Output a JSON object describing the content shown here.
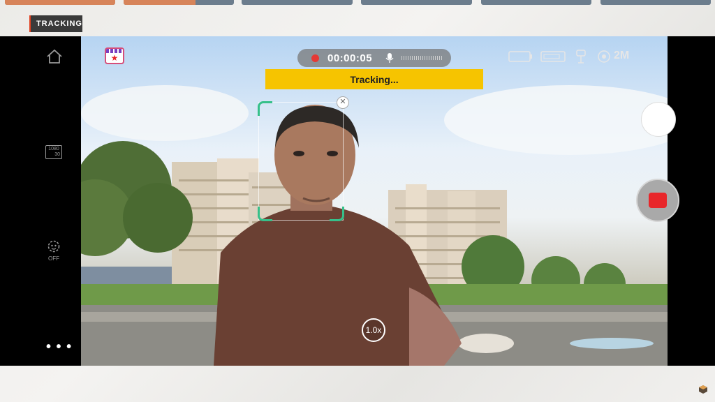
{
  "overlay": {
    "tag_label": "TRACKING"
  },
  "progress_segments": [
    {
      "name": "segment-1",
      "fill": 1.0
    },
    {
      "name": "segment-2",
      "fill": 0.65
    },
    {
      "name": "segment-3",
      "fill": 0
    },
    {
      "name": "segment-4",
      "fill": 0
    },
    {
      "name": "segment-5",
      "fill": 0
    },
    {
      "name": "segment-6",
      "fill": 0
    }
  ],
  "camera": {
    "recording_time": "00:00:05",
    "tracking_banner": "Tracking...",
    "zoom_label": "1.0x",
    "left_rail": {
      "resolution_top": "1080",
      "resolution_bottom": "30",
      "face_tracking_state": "OFF",
      "more_label": "• • •"
    },
    "status_icons": [
      "battery-icon",
      "card-icon",
      "tripod-icon",
      "stabilizer-icon"
    ],
    "status_text": "2M"
  },
  "colors": {
    "accent_orange": "#d7845a",
    "segment_gray": "#6c7d8d",
    "tracking_yellow": "#f6c400",
    "record_red": "#e8262a",
    "tracker_green": "#36c08a"
  }
}
